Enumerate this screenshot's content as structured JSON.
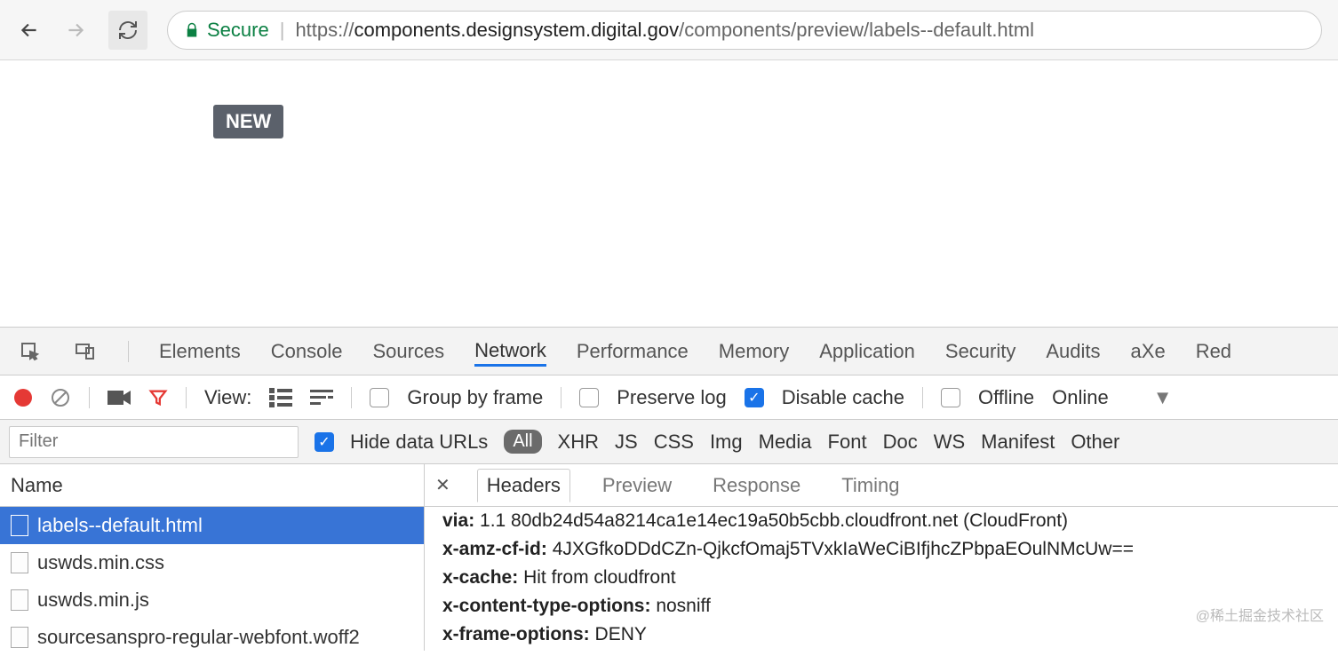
{
  "browser": {
    "secure_label": "Secure",
    "url_scheme": "https://",
    "url_host": "components.designsystem.digital.gov",
    "url_path": "/components/preview/labels--default.html"
  },
  "page": {
    "label_text": "NEW"
  },
  "devtools": {
    "tabs": [
      "Elements",
      "Console",
      "Sources",
      "Network",
      "Performance",
      "Memory",
      "Application",
      "Security",
      "Audits",
      "aXe",
      "Red"
    ],
    "active_tab": "Network",
    "netbar": {
      "view_label": "View:",
      "group_by_frame": "Group by frame",
      "preserve_log": "Preserve log",
      "disable_cache": "Disable cache",
      "offline": "Offline",
      "online": "Online"
    },
    "filters": {
      "placeholder": "Filter",
      "hide_data_urls": "Hide data URLs",
      "types": [
        "All",
        "XHR",
        "JS",
        "CSS",
        "Img",
        "Media",
        "Font",
        "Doc",
        "WS",
        "Manifest",
        "Other"
      ]
    },
    "left": {
      "header": "Name",
      "files": [
        "labels--default.html",
        "uswds.min.css",
        "uswds.min.js",
        "sourcesanspro-regular-webfont.woff2"
      ]
    },
    "right": {
      "tabs": [
        "Headers",
        "Preview",
        "Response",
        "Timing"
      ],
      "headers": [
        {
          "k": "via:",
          "v": "1.1 80db24d54a8214ca1e14ec19a50b5cbb.cloudfront.net (CloudFront)"
        },
        {
          "k": "x-amz-cf-id:",
          "v": "4JXGfkoDDdCZn-QjkcfOmaj5TVxkIaWeCiBIfjhcZPbpaEOulNMcUw=="
        },
        {
          "k": "x-cache:",
          "v": "Hit from cloudfront"
        },
        {
          "k": "x-content-type-options:",
          "v": "nosniff"
        },
        {
          "k": "x-frame-options:",
          "v": "DENY"
        }
      ]
    }
  },
  "watermark": "@稀土掘金技术社区"
}
